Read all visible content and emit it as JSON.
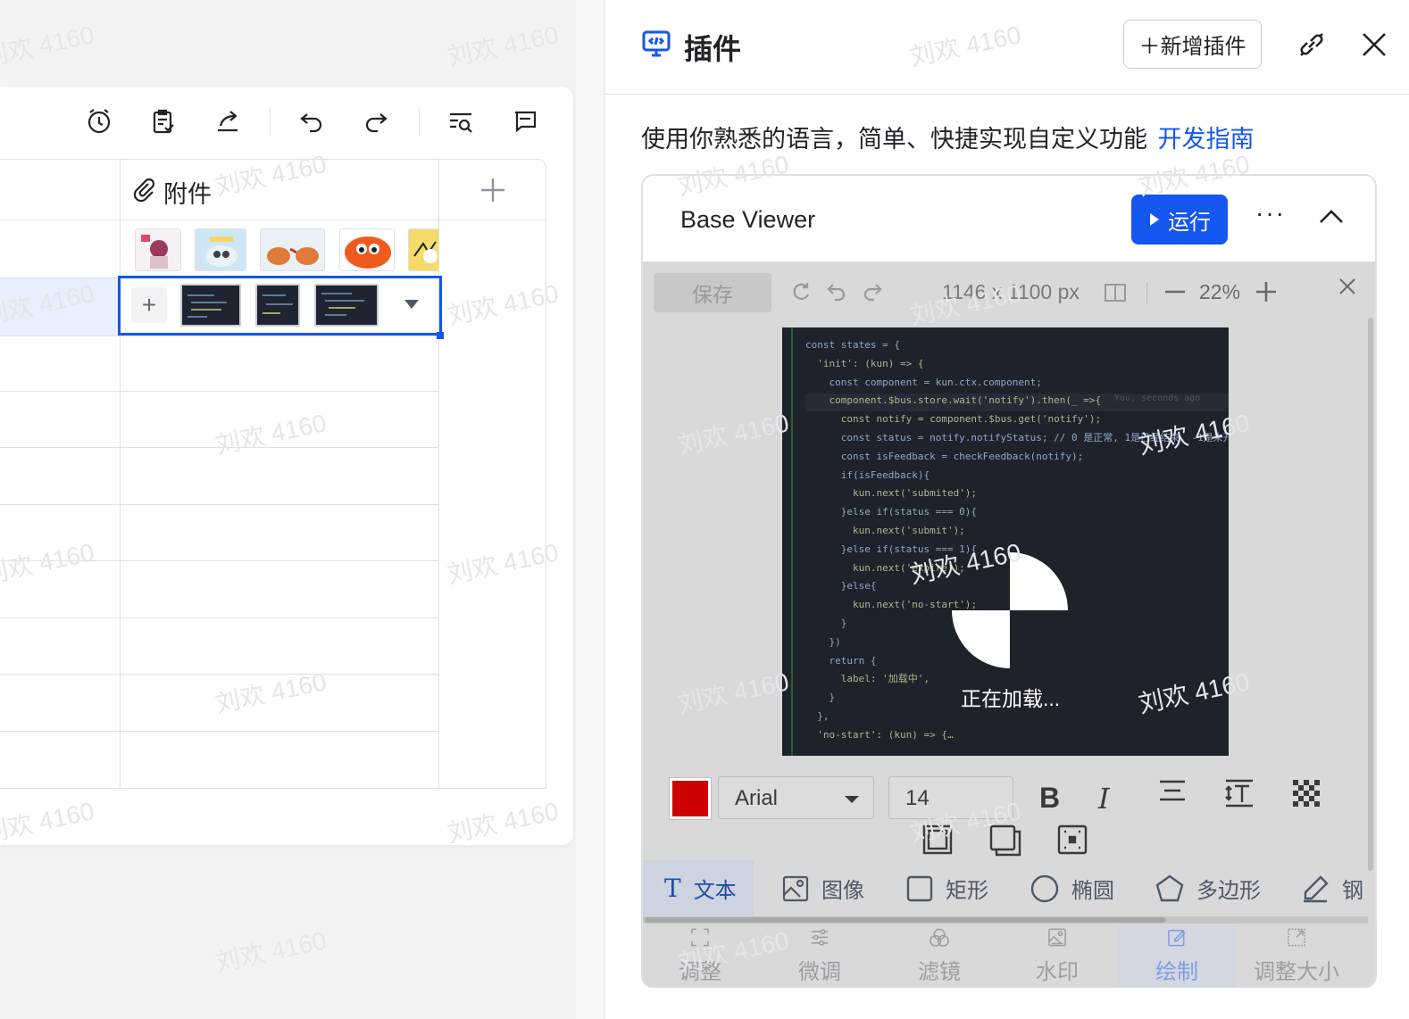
{
  "sheet": {
    "column_header": "附件",
    "add_column_icon": "plus-icon",
    "toolbar_icons": [
      "alarm-clock-icon",
      "checklist-icon",
      "share-icon",
      "undo-icon",
      "redo-icon",
      "search-list-icon",
      "comment-icon"
    ],
    "add_attachment": "+"
  },
  "panel": {
    "title": "插件",
    "add_plugin": "＋新增插件",
    "description": "使用你熟悉的语言，简单、快捷实现自定义功能",
    "guide_link": "开发指南",
    "accent_color": "#1456f0",
    "plugin": {
      "name": "Base Viewer",
      "run_label": "运行",
      "more": "···"
    },
    "editor": {
      "save_label": "保存",
      "dimensions": "1146 x 1100 px",
      "zoom": "22%",
      "loading_text": "正在加载...",
      "color": "#cc0000",
      "font": "Arial",
      "font_size": "14",
      "bold": "B",
      "italic": "I",
      "tools": [
        {
          "icon": "T",
          "label": "文本"
        },
        {
          "icon": "image-icon",
          "label": "图像"
        },
        {
          "icon": "rect-icon",
          "label": "矩形"
        },
        {
          "icon": "ellipse-icon",
          "label": "椭圆"
        },
        {
          "icon": "polygon-icon",
          "label": "多边形"
        },
        {
          "icon": "pen-icon",
          "label": "钢"
        }
      ],
      "bottom_tabs": [
        {
          "icon": "crop-icon",
          "label": "调整"
        },
        {
          "icon": "sliders-icon",
          "label": "微调"
        },
        {
          "icon": "filter-icon",
          "label": "滤镜"
        },
        {
          "icon": "watermark-icon",
          "label": "水印"
        },
        {
          "icon": "draw-icon",
          "label": "绘制"
        },
        {
          "icon": "resize-icon",
          "label": "调整大小"
        }
      ]
    }
  },
  "code_lines": [
    "const states = {",
    "  'init': (kun) => {",
    "    const component = kun.ctx.component;",
    "    component.$bus.store.wait('notify').then(_ =>{",
    "      const notify = component.$bus.get('notify');",
    "      const status = notify.notifyStatus; // 0 是正常, 1是已经结束, -1是未开始",
    "      const isFeedback = checkFeedback(notify);",
    "      if(isFeedback){",
    "        kun.next('submited');",
    "      }else if(status === 0){",
    "        kun.next('submit');",
    "      }else if(status === 1){",
    "        kun.next('expire');",
    "      }else{",
    "        kun.next('no-start');",
    "      }",
    "    })",
    "    return {",
    "      label: '加载中',",
    "    }",
    "  },",
    "  'no-start': (kun) => {…"
  ],
  "code_hint": "You, seconds ago",
  "watermark": "刘欢 4160"
}
